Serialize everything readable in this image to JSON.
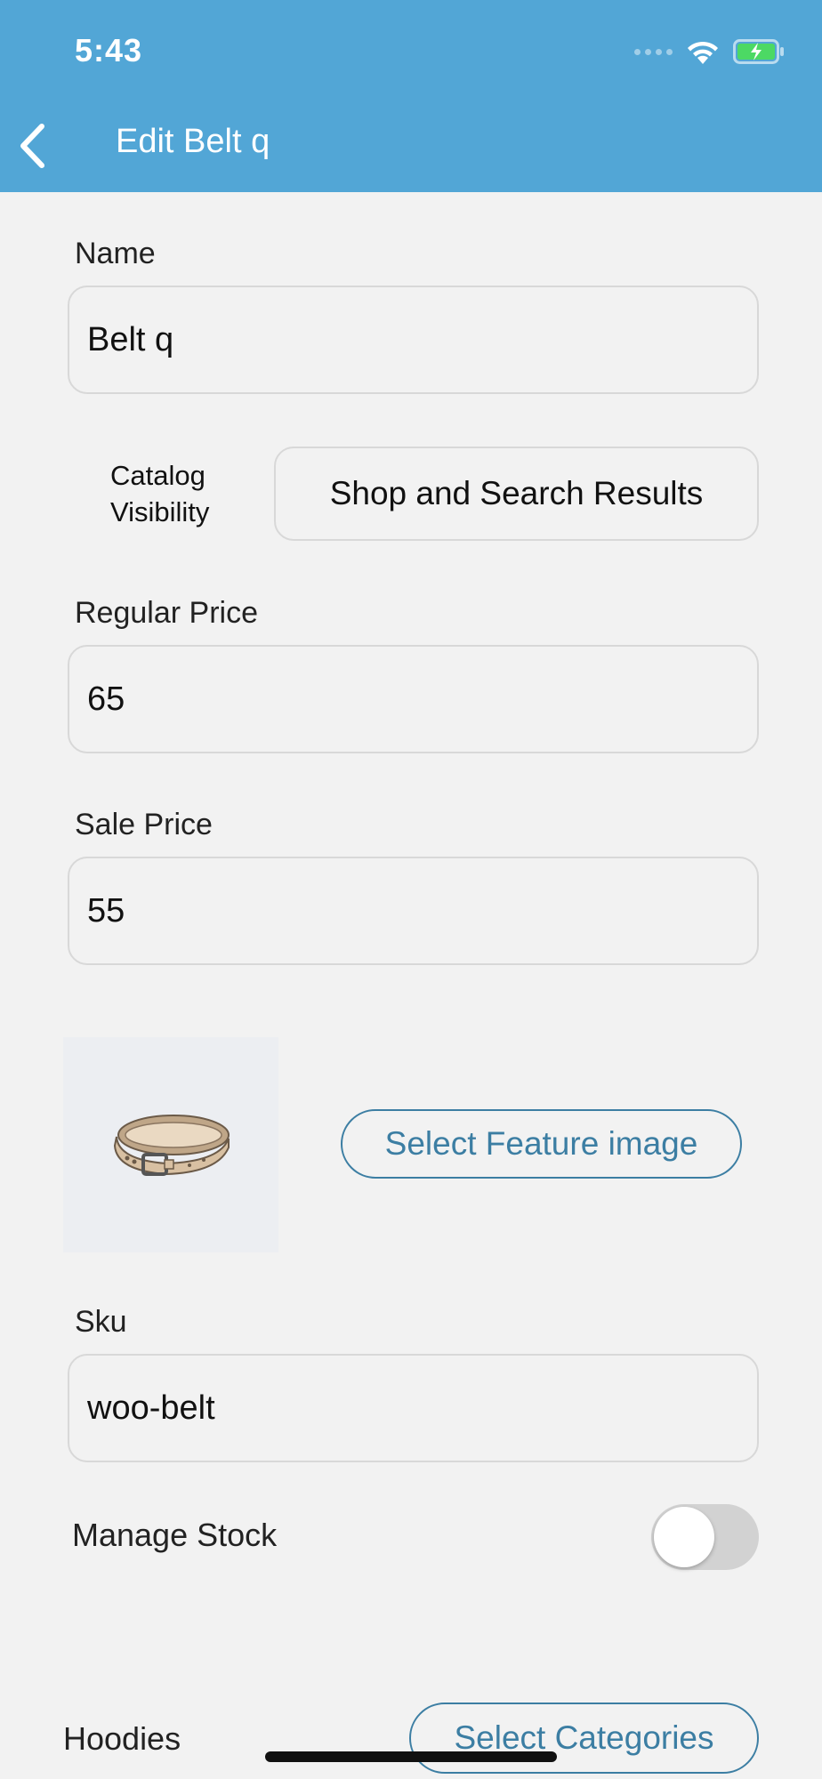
{
  "status_bar": {
    "time": "5:43"
  },
  "nav": {
    "title": "Edit Belt q"
  },
  "form": {
    "name_label": "Name",
    "name_value": "Belt q",
    "catalog_visibility_label_line1": "Catalog",
    "catalog_visibility_label_line2": "Visibility",
    "catalog_visibility_value": "Shop and Search Results",
    "regular_price_label": "Regular Price",
    "regular_price_value": "65",
    "sale_price_label": "Sale Price",
    "sale_price_value": "55",
    "select_feature_image_label": "Select Feature image",
    "sku_label": "Sku",
    "sku_value": "woo-belt",
    "manage_stock_label": "Manage Stock",
    "manage_stock_on": false,
    "category_value": "Hoodies",
    "select_categories_label": "Select Categories"
  },
  "colors": {
    "header": "#52a6d6",
    "accent": "#3c7ea3",
    "background": "#f2f2f2",
    "battery": "#4cd964"
  },
  "icons": {
    "back": "chevron-left-icon",
    "wifi": "wifi-icon",
    "battery": "battery-charging-icon",
    "signal": "cellular-signal-icon"
  }
}
